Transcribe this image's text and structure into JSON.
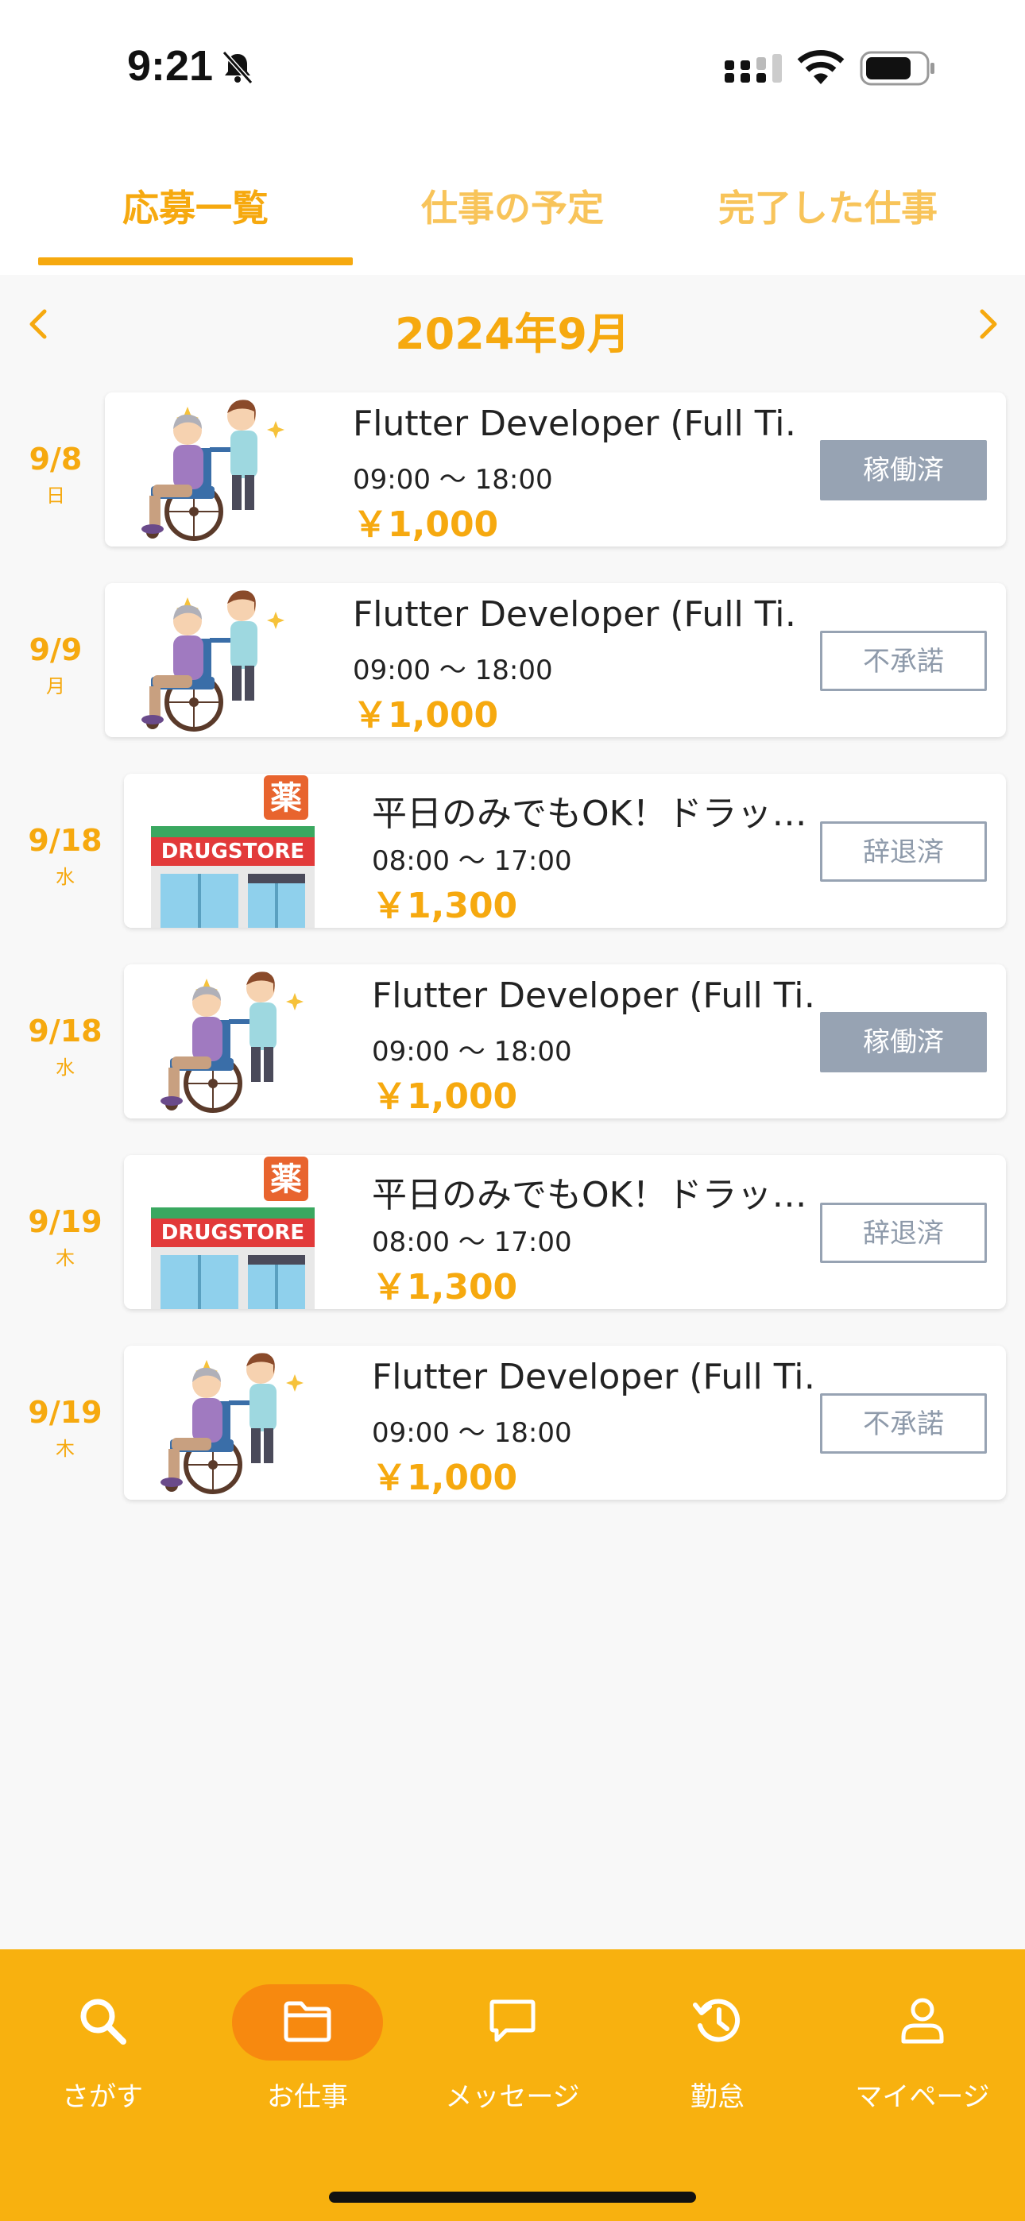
{
  "status_bar": {
    "time": "9:21"
  },
  "tabs": [
    {
      "label": "応募一覧",
      "active": true
    },
    {
      "label": "仕事の予定",
      "active": false
    },
    {
      "label": "完了した仕事",
      "active": false
    }
  ],
  "month_nav": {
    "label": "2024年9月"
  },
  "jobs": [
    {
      "date": "9/8",
      "weekday": "日",
      "image": "caregiver",
      "title": "Flutter Developer (Full Ti…",
      "time": "09:00 〜 18:00",
      "pay": "￥1,000",
      "status": "稼働済",
      "status_style": "filled"
    },
    {
      "date": "9/9",
      "weekday": "月",
      "image": "caregiver",
      "title": "Flutter Developer (Full Ti…",
      "time": "09:00 〜 18:00",
      "pay": "￥1,000",
      "status": "不承諾",
      "status_style": "outline"
    },
    {
      "date": "9/18",
      "weekday": "水",
      "image": "drugstore",
      "title": "平日のみでもOK！ドラッ…",
      "time": "08:00 〜 17:00",
      "pay": "￥1,300",
      "status": "辞退済",
      "status_style": "outline"
    },
    {
      "date": "9/18",
      "weekday": "水",
      "image": "caregiver",
      "title": "Flutter Developer (Full Ti…",
      "time": "09:00 〜 18:00",
      "pay": "￥1,000",
      "status": "稼働済",
      "status_style": "filled"
    },
    {
      "date": "9/19",
      "weekday": "木",
      "image": "drugstore",
      "title": "平日のみでもOK！ドラッ…",
      "time": "08:00 〜 17:00",
      "pay": "￥1,300",
      "status": "辞退済",
      "status_style": "outline"
    },
    {
      "date": "9/19",
      "weekday": "木",
      "image": "caregiver",
      "title": "Flutter Developer (Full Ti…",
      "time": "09:00 〜 18:00",
      "pay": "￥1,000",
      "status": "不承諾",
      "status_style": "outline"
    }
  ],
  "drugstore_sign": {
    "kanji": "薬",
    "text": "DRUGSTORE"
  },
  "bottom_nav": [
    {
      "label": "さがす",
      "icon": "search-icon",
      "active": false
    },
    {
      "label": "お仕事",
      "icon": "folder-icon",
      "active": true
    },
    {
      "label": "メッセージ",
      "icon": "message-icon",
      "active": false
    },
    {
      "label": "勤怠",
      "icon": "history-icon",
      "active": false
    },
    {
      "label": "マイページ",
      "icon": "person-icon",
      "active": false
    }
  ],
  "colors": {
    "accent": "#f6a90f",
    "accent_light": "#f8c45a",
    "nav_background": "#f8b10f",
    "nav_active_pill": "#f7890f",
    "status_gray": "#97a3b3"
  }
}
